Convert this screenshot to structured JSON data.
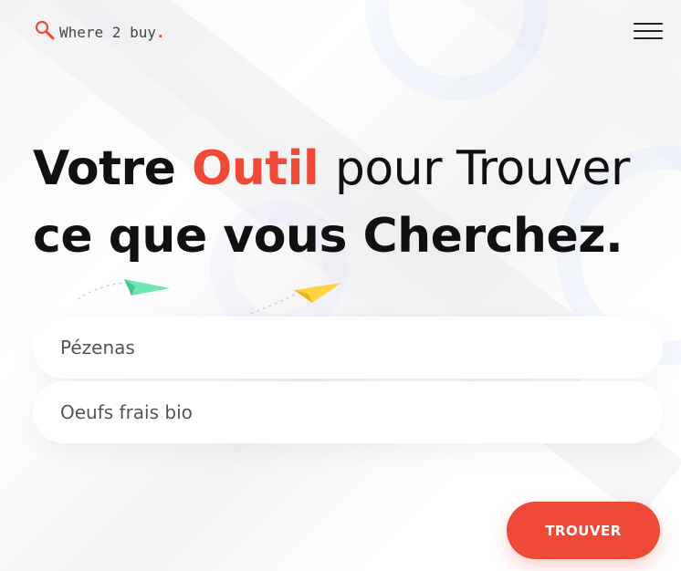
{
  "brand": {
    "name": "Where 2 buy",
    "dot": "."
  },
  "icons": {
    "logo": "magnifier-icon",
    "menu": "hamburger-menu-icon",
    "decor": "paper-plane-icon"
  },
  "hero": {
    "word1": "Votre",
    "accent": "Outil",
    "rest_line1": "pour Trouver",
    "line2": "ce que vous Cherchez."
  },
  "search": {
    "location_value": "Pézenas",
    "query_value": "Oeufs frais bio"
  },
  "submit_label": "TROUVER",
  "colors": {
    "accent": "#ef4a37",
    "plane_green": "#6ee6b2",
    "plane_yellow": "#ffd23f"
  }
}
